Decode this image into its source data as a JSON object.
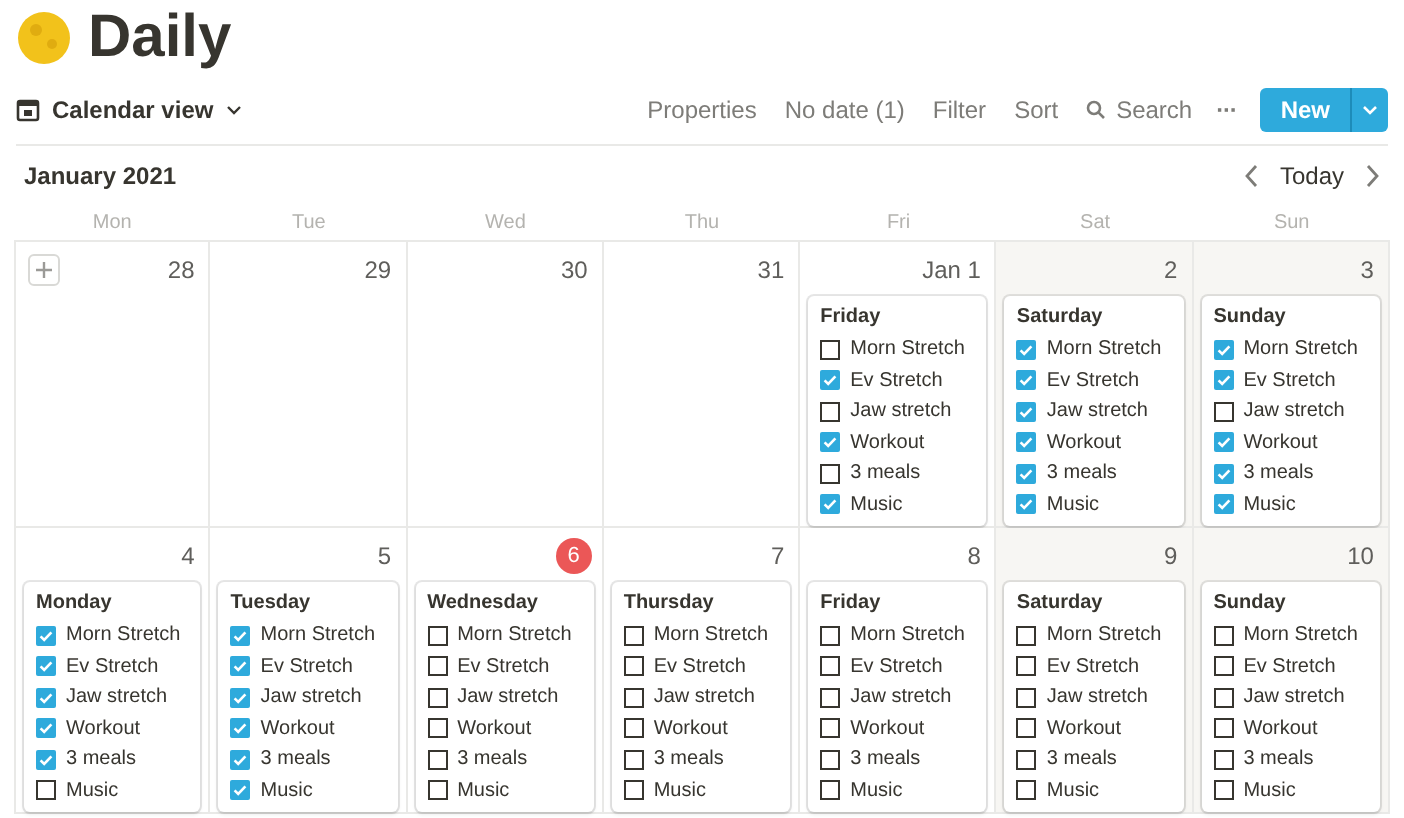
{
  "page": {
    "title": "Daily"
  },
  "toolbar": {
    "view": "Calendar view",
    "actions": [
      "Properties",
      "No date (1)",
      "Filter",
      "Sort"
    ],
    "search": "Search",
    "more": "···",
    "new_button": "New"
  },
  "calendar": {
    "month": "January 2021",
    "today_button": "Today",
    "weekdays": [
      "Mon",
      "Tue",
      "Wed",
      "Thu",
      "Fri",
      "Sat",
      "Sun"
    ],
    "weeks": [
      [
        {
          "date": "28",
          "weekend": false,
          "today": false,
          "add": true
        },
        {
          "date": "29",
          "weekend": false,
          "today": false
        },
        {
          "date": "30",
          "weekend": false,
          "today": false
        },
        {
          "date": "31",
          "weekend": false,
          "today": false
        },
        {
          "date": "Jan 1",
          "weekend": false,
          "today": false,
          "card": {
            "title": "Friday",
            "items": [
              {
                "label": "Morn Stretch",
                "checked": false
              },
              {
                "label": "Ev Stretch",
                "checked": true
              },
              {
                "label": "Jaw stretch",
                "checked": false
              },
              {
                "label": "Workout",
                "checked": true
              },
              {
                "label": "3 meals",
                "checked": false
              },
              {
                "label": "Music",
                "checked": true
              }
            ]
          }
        },
        {
          "date": "2",
          "weekend": true,
          "today": false,
          "card": {
            "title": "Saturday",
            "items": [
              {
                "label": "Morn Stretch",
                "checked": true
              },
              {
                "label": "Ev Stretch",
                "checked": true
              },
              {
                "label": "Jaw stretch",
                "checked": true
              },
              {
                "label": "Workout",
                "checked": true
              },
              {
                "label": "3 meals",
                "checked": true
              },
              {
                "label": "Music",
                "checked": true
              }
            ]
          }
        },
        {
          "date": "3",
          "weekend": true,
          "today": false,
          "card": {
            "title": "Sunday",
            "items": [
              {
                "label": "Morn Stretch",
                "checked": true
              },
              {
                "label": "Ev Stretch",
                "checked": true
              },
              {
                "label": "Jaw stretch",
                "checked": false
              },
              {
                "label": "Workout",
                "checked": true
              },
              {
                "label": "3 meals",
                "checked": true
              },
              {
                "label": "Music",
                "checked": true
              }
            ]
          }
        }
      ],
      [
        {
          "date": "4",
          "weekend": false,
          "today": false,
          "card": {
            "title": "Monday",
            "items": [
              {
                "label": "Morn Stretch",
                "checked": true
              },
              {
                "label": "Ev Stretch",
                "checked": true
              },
              {
                "label": "Jaw stretch",
                "checked": true
              },
              {
                "label": "Workout",
                "checked": true
              },
              {
                "label": "3 meals",
                "checked": true
              },
              {
                "label": "Music",
                "checked": false
              }
            ]
          }
        },
        {
          "date": "5",
          "weekend": false,
          "today": false,
          "card": {
            "title": "Tuesday",
            "items": [
              {
                "label": "Morn Stretch",
                "checked": true
              },
              {
                "label": "Ev Stretch",
                "checked": true
              },
              {
                "label": "Jaw stretch",
                "checked": true
              },
              {
                "label": "Workout",
                "checked": true
              },
              {
                "label": "3 meals",
                "checked": true
              },
              {
                "label": "Music",
                "checked": true
              }
            ]
          }
        },
        {
          "date": "6",
          "weekend": false,
          "today": true,
          "card": {
            "title": "Wednesday",
            "items": [
              {
                "label": "Morn Stretch",
                "checked": false
              },
              {
                "label": "Ev Stretch",
                "checked": false
              },
              {
                "label": "Jaw stretch",
                "checked": false
              },
              {
                "label": "Workout",
                "checked": false
              },
              {
                "label": "3 meals",
                "checked": false
              },
              {
                "label": "Music",
                "checked": false
              }
            ]
          }
        },
        {
          "date": "7",
          "weekend": false,
          "today": false,
          "card": {
            "title": "Thursday",
            "items": [
              {
                "label": "Morn Stretch",
                "checked": false
              },
              {
                "label": "Ev Stretch",
                "checked": false
              },
              {
                "label": "Jaw stretch",
                "checked": false
              },
              {
                "label": "Workout",
                "checked": false
              },
              {
                "label": "3 meals",
                "checked": false
              },
              {
                "label": "Music",
                "checked": false
              }
            ]
          }
        },
        {
          "date": "8",
          "weekend": false,
          "today": false,
          "card": {
            "title": "Friday",
            "items": [
              {
                "label": "Morn Stretch",
                "checked": false
              },
              {
                "label": "Ev Stretch",
                "checked": false
              },
              {
                "label": "Jaw stretch",
                "checked": false
              },
              {
                "label": "Workout",
                "checked": false
              },
              {
                "label": "3 meals",
                "checked": false
              },
              {
                "label": "Music",
                "checked": false
              }
            ]
          }
        },
        {
          "date": "9",
          "weekend": true,
          "today": false,
          "card": {
            "title": "Saturday",
            "items": [
              {
                "label": "Morn Stretch",
                "checked": false
              },
              {
                "label": "Ev Stretch",
                "checked": false
              },
              {
                "label": "Jaw stretch",
                "checked": false
              },
              {
                "label": "Workout",
                "checked": false
              },
              {
                "label": "3 meals",
                "checked": false
              },
              {
                "label": "Music",
                "checked": false
              }
            ]
          }
        },
        {
          "date": "10",
          "weekend": true,
          "today": false,
          "card": {
            "title": "Sunday",
            "items": [
              {
                "label": "Morn Stretch",
                "checked": false
              },
              {
                "label": "Ev Stretch",
                "checked": false
              },
              {
                "label": "Jaw stretch",
                "checked": false
              },
              {
                "label": "Workout",
                "checked": false
              },
              {
                "label": "3 meals",
                "checked": false
              },
              {
                "label": "Music",
                "checked": false
              }
            ]
          }
        }
      ]
    ]
  }
}
